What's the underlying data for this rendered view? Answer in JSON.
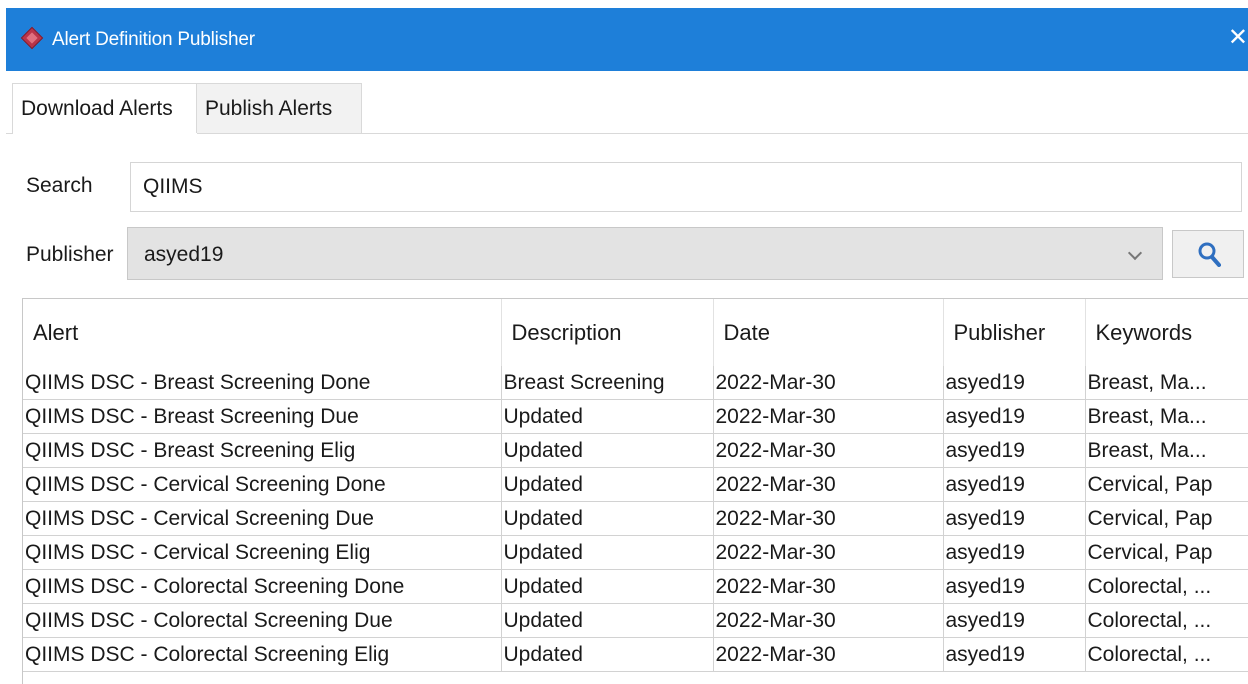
{
  "window": {
    "title": "Alert Definition Publisher",
    "close_glyph": "✕"
  },
  "tabs": [
    {
      "label": "Download Alerts"
    },
    {
      "label": "Publish Alerts"
    }
  ],
  "search": {
    "label": "Search",
    "value": "QIIMS"
  },
  "publisher": {
    "label": "Publisher",
    "value": "asyed19"
  },
  "table": {
    "columns": [
      "Alert",
      "Description",
      "Date",
      "Publisher",
      "Keywords"
    ],
    "rows": [
      [
        "QIIMS DSC - Breast Screening Done",
        "Breast Screening",
        "2022-Mar-30",
        "asyed19",
        "Breast, Ma..."
      ],
      [
        "QIIMS DSC - Breast Screening Due",
        "Updated",
        "2022-Mar-30",
        "asyed19",
        "Breast, Ma..."
      ],
      [
        "QIIMS DSC - Breast Screening Elig",
        "Updated",
        "2022-Mar-30",
        "asyed19",
        "Breast, Ma..."
      ],
      [
        "QIIMS DSC - Cervical Screening Done",
        "Updated",
        "2022-Mar-30",
        "asyed19",
        "Cervical, Pap"
      ],
      [
        "QIIMS DSC - Cervical Screening Due",
        "Updated",
        "2022-Mar-30",
        "asyed19",
        "Cervical, Pap"
      ],
      [
        "QIIMS DSC - Cervical Screening Elig",
        "Updated",
        "2022-Mar-30",
        "asyed19",
        "Cervical, Pap"
      ],
      [
        "QIIMS DSC - Colorectal Screening Done",
        "Updated",
        "2022-Mar-30",
        "asyed19",
        "Colorectal, ..."
      ],
      [
        "QIIMS DSC - Colorectal Screening Due",
        "Updated",
        "2022-Mar-30",
        "asyed19",
        "Colorectal, ..."
      ],
      [
        "QIIMS DSC - Colorectal Screening Elig",
        "Updated",
        "2022-Mar-30",
        "asyed19",
        "Colorectal, ..."
      ]
    ]
  },
  "icons": {
    "app": "app-diamond-icon",
    "search": "magnifier-search-icon",
    "dropdown": "chevron-down-icon",
    "close": "close-icon"
  },
  "colors": {
    "titlebar": "#1e7fd9",
    "app_icon": "#b8344a",
    "search_icon": "#2f6fc0"
  }
}
